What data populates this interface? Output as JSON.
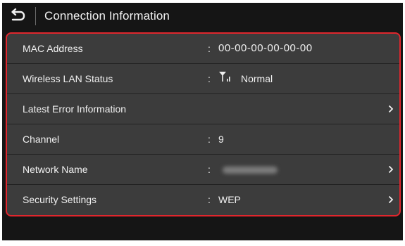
{
  "header": {
    "title": "Connection Information",
    "back_icon": "back-arrow-icon"
  },
  "colors": {
    "background": "#151515",
    "row_background": "#3c3c3c",
    "highlight_border": "#e0262d",
    "text": "#f0f0f0"
  },
  "rows": [
    {
      "label": "MAC Address",
      "colon": ":",
      "value": "00-00-00-00-00-00",
      "has_chevron": false
    },
    {
      "label": "Wireless LAN Status",
      "colon": ":",
      "value": "Normal",
      "icon": "signal-strength-icon",
      "has_chevron": false
    },
    {
      "label": "Latest Error Information",
      "colon": "",
      "value": "",
      "has_chevron": true
    },
    {
      "label": "Channel",
      "colon": ":",
      "value": "9",
      "has_chevron": false
    },
    {
      "label": "Network Name",
      "colon": ":",
      "value": "",
      "value_redacted": true,
      "has_chevron": true
    },
    {
      "label": "Security Settings",
      "colon": ":",
      "value": "WEP",
      "has_chevron": true
    }
  ]
}
